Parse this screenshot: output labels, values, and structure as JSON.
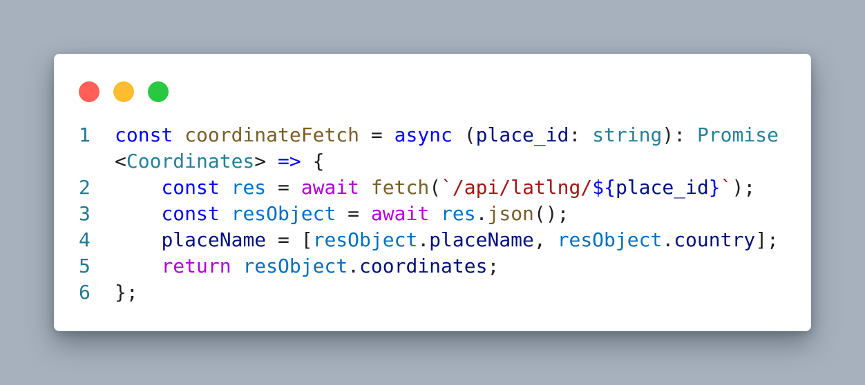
{
  "window": {
    "controls": {
      "close_color": "#ff5f57",
      "minimize_color": "#febc2e",
      "maximize_color": "#28c840"
    }
  },
  "code": {
    "lines": [
      {
        "number": "1",
        "tokens": [
          {
            "text": "const",
            "kind": "keyword"
          },
          {
            "text": " "
          },
          {
            "text": "coordinateFetch",
            "kind": "function"
          },
          {
            "text": " = "
          },
          {
            "text": "async",
            "kind": "keyword"
          },
          {
            "text": " ("
          },
          {
            "text": "place_id",
            "kind": "variable"
          },
          {
            "text": ": "
          },
          {
            "text": "string",
            "kind": "type"
          },
          {
            "text": "): "
          },
          {
            "text": "Promise",
            "kind": "type"
          }
        ]
      },
      {
        "number": "",
        "tokens": [
          {
            "text": "<"
          },
          {
            "text": "Coordinates",
            "kind": "type"
          },
          {
            "text": "> "
          },
          {
            "text": "=>",
            "kind": "keyword"
          },
          {
            "text": " {"
          }
        ]
      },
      {
        "number": "2",
        "tokens": [
          {
            "text": "    "
          },
          {
            "text": "const",
            "kind": "keyword"
          },
          {
            "text": " "
          },
          {
            "text": "res",
            "kind": "constant"
          },
          {
            "text": " = "
          },
          {
            "text": "await",
            "kind": "control"
          },
          {
            "text": " "
          },
          {
            "text": "fetch",
            "kind": "function"
          },
          {
            "text": "("
          },
          {
            "text": "`/api/latlng/",
            "kind": "string"
          },
          {
            "text": "${",
            "kind": "keyword"
          },
          {
            "text": "place_id",
            "kind": "variable"
          },
          {
            "text": "}",
            "kind": "keyword"
          },
          {
            "text": "`",
            "kind": "string"
          },
          {
            "text": ");"
          }
        ]
      },
      {
        "number": "3",
        "tokens": [
          {
            "text": "    "
          },
          {
            "text": "const",
            "kind": "keyword"
          },
          {
            "text": " "
          },
          {
            "text": "resObject",
            "kind": "constant"
          },
          {
            "text": " = "
          },
          {
            "text": "await",
            "kind": "control"
          },
          {
            "text": " "
          },
          {
            "text": "res",
            "kind": "constant"
          },
          {
            "text": "."
          },
          {
            "text": "json",
            "kind": "function"
          },
          {
            "text": "();"
          }
        ]
      },
      {
        "number": "4",
        "tokens": [
          {
            "text": "    "
          },
          {
            "text": "placeName",
            "kind": "variable"
          },
          {
            "text": " = ["
          },
          {
            "text": "resObject",
            "kind": "constant"
          },
          {
            "text": "."
          },
          {
            "text": "placeName",
            "kind": "variable"
          },
          {
            "text": ", "
          },
          {
            "text": "resObject",
            "kind": "constant"
          },
          {
            "text": "."
          },
          {
            "text": "country",
            "kind": "variable"
          },
          {
            "text": "];"
          }
        ]
      },
      {
        "number": "5",
        "tokens": [
          {
            "text": "    "
          },
          {
            "text": "return",
            "kind": "control"
          },
          {
            "text": " "
          },
          {
            "text": "resObject",
            "kind": "constant"
          },
          {
            "text": "."
          },
          {
            "text": "coordinates",
            "kind": "variable"
          },
          {
            "text": ";"
          }
        ]
      },
      {
        "number": "6",
        "tokens": [
          {
            "text": "};"
          }
        ]
      }
    ]
  }
}
